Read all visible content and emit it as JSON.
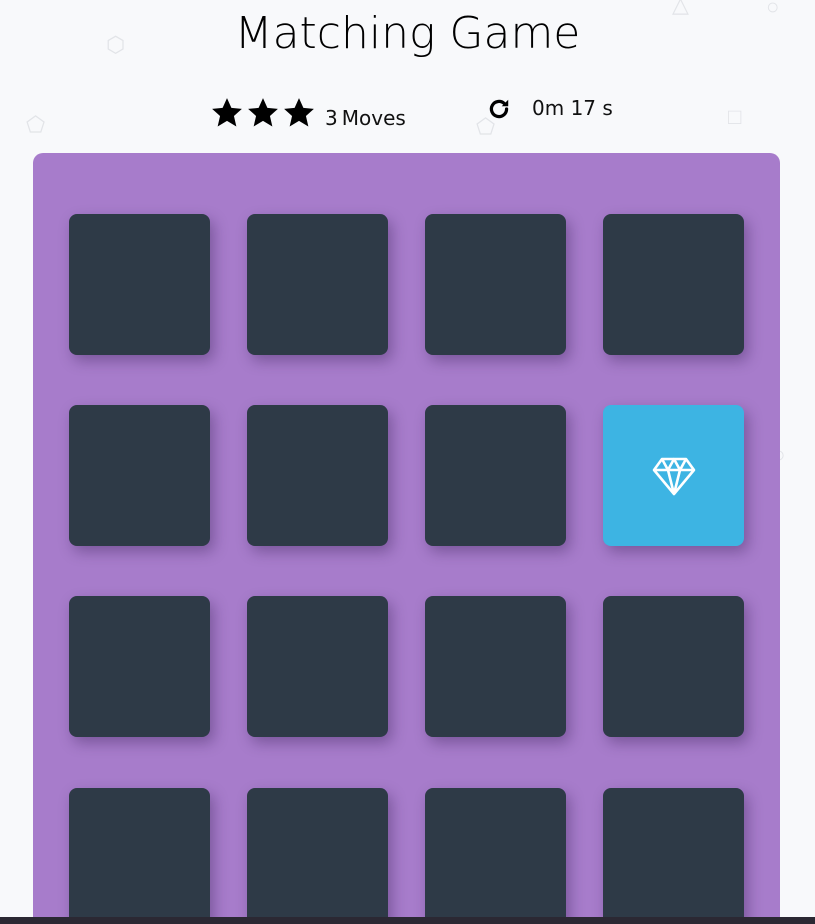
{
  "title": "Matching Game",
  "score_panel": {
    "stars": [
      "star-icon",
      "star-icon",
      "star-icon"
    ],
    "moves_count": "3",
    "moves_label": "Moves",
    "restart_icon": "restart-icon",
    "timer": "0m 17 s"
  },
  "colors": {
    "deck": "#a77ccb",
    "card_closed": "#2e3a47",
    "card_open": "#3db4e3",
    "background": "#f8f9fb"
  },
  "deck": {
    "cards": [
      {
        "state": "closed",
        "icon": ""
      },
      {
        "state": "closed",
        "icon": ""
      },
      {
        "state": "closed",
        "icon": ""
      },
      {
        "state": "closed",
        "icon": ""
      },
      {
        "state": "closed",
        "icon": ""
      },
      {
        "state": "closed",
        "icon": ""
      },
      {
        "state": "closed",
        "icon": ""
      },
      {
        "state": "open",
        "icon": "diamond-icon"
      },
      {
        "state": "closed",
        "icon": ""
      },
      {
        "state": "closed",
        "icon": ""
      },
      {
        "state": "closed",
        "icon": ""
      },
      {
        "state": "closed",
        "icon": ""
      },
      {
        "state": "closed",
        "icon": ""
      },
      {
        "state": "closed",
        "icon": ""
      },
      {
        "state": "closed",
        "icon": ""
      },
      {
        "state": "closed",
        "icon": ""
      }
    ]
  }
}
